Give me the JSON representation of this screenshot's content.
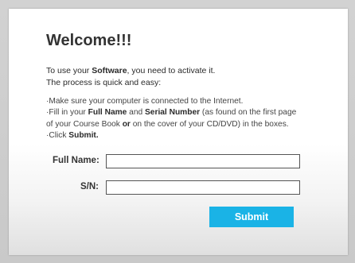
{
  "welcome": {
    "title": "Welcome!!!",
    "intro_line1_pre": "To use your ",
    "intro_line1_bold": "Software",
    "intro_line1_post": ", you need to activate it.",
    "intro_line2": "The process is quick and easy:"
  },
  "steps": {
    "line1": "·Make sure your computer is connected to the Internet.",
    "line2_pre": "·Fill in your ",
    "line2_bold1": "Full Name",
    "line2_mid": " and ",
    "line2_bold2": "Serial Number",
    "line2_post": " (as found on the first page",
    "line3_pre": "of your Course Book ",
    "line3_bold": "or",
    "line3_post": " on the cover of your CD/DVD) in the boxes.",
    "line4_pre": "·Click ",
    "line4_bold": "Submit."
  },
  "form": {
    "full_name_label": "Full Name:",
    "full_name_value": "",
    "sn_label": "S/N:",
    "sn_value": "",
    "submit_label": "Submit"
  },
  "colors": {
    "accent": "#1ab3e6",
    "title_text": "#333333"
  }
}
